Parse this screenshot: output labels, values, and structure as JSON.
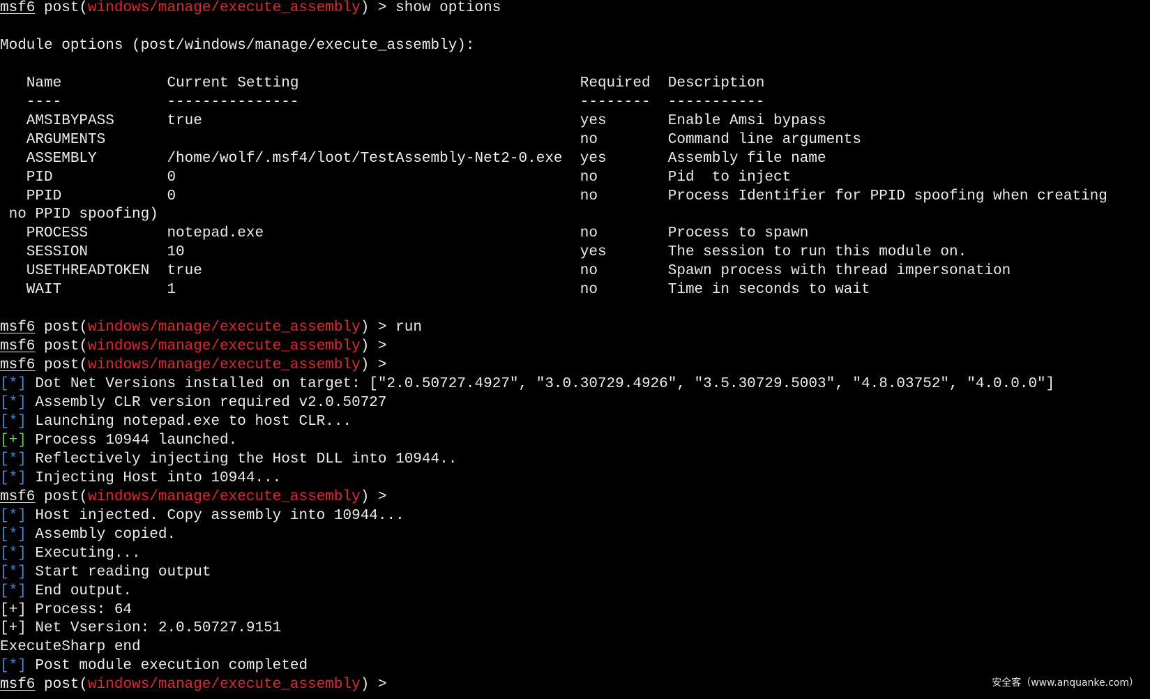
{
  "colors": {
    "background": "#000000",
    "text": "#ececec",
    "module_path": "#e8242a",
    "info_bracket": "#3d8ed6",
    "success_bracket": "#62d12b"
  },
  "prompt": {
    "msf": "msf6",
    "post": " post(",
    "module": "windows/manage/execute_assembly",
    "close": ") > "
  },
  "lines": [
    {
      "type": "prompt",
      "text": "show options"
    },
    {
      "type": "blank",
      "text": ""
    },
    {
      "type": "text",
      "text": "Module options (post/windows/manage/execute_assembly):"
    },
    {
      "type": "blank",
      "text": ""
    },
    {
      "type": "text",
      "text": "   Name            Current Setting                                Required  Description"
    },
    {
      "type": "text",
      "text": "   ----            ---------------                                --------  -----------"
    },
    {
      "type": "text",
      "text": "   AMSIBYPASS      true                                           yes       Enable Amsi bypass"
    },
    {
      "type": "text",
      "text": "   ARGUMENTS                                                      no        Command line arguments"
    },
    {
      "type": "text",
      "text": "   ASSEMBLY        /home/wolf/.msf4/loot/TestAssembly-Net2-0.exe  yes       Assembly file name"
    },
    {
      "type": "text",
      "text": "   PID             0                                              no        Pid  to inject"
    },
    {
      "type": "text",
      "text": "   PPID            0                                              no        Process Identifier for PPID spoofing when creating"
    },
    {
      "type": "text",
      "text": " no PPID spoofing)"
    },
    {
      "type": "text",
      "text": "   PROCESS         notepad.exe                                    no        Process to spawn"
    },
    {
      "type": "text",
      "text": "   SESSION         10                                             yes       The session to run this module on."
    },
    {
      "type": "text",
      "text": "   USETHREADTOKEN  true                                           no        Spawn process with thread impersonation"
    },
    {
      "type": "text",
      "text": "   WAIT            1                                              no        Time in seconds to wait"
    },
    {
      "type": "blank",
      "text": ""
    },
    {
      "type": "prompt",
      "text": "run"
    },
    {
      "type": "prompt",
      "text": ""
    },
    {
      "type": "prompt",
      "text": ""
    },
    {
      "type": "info",
      "marker": "[*]",
      "text": " Dot Net Versions installed on target: [\"2.0.50727.4927\", \"3.0.30729.4926\", \"3.5.30729.5003\", \"4.8.03752\", \"4.0.0.0\"]"
    },
    {
      "type": "info",
      "marker": "[*]",
      "text": " Assembly CLR version required v2.0.50727"
    },
    {
      "type": "info",
      "marker": "[*]",
      "text": " Launching notepad.exe to host CLR..."
    },
    {
      "type": "success",
      "marker": "[+]",
      "text": " Process 10944 launched."
    },
    {
      "type": "info",
      "marker": "[*]",
      "text": " Reflectively injecting the Host DLL into 10944.."
    },
    {
      "type": "info",
      "marker": "[*]",
      "text": " Injecting Host into 10944..."
    },
    {
      "type": "prompt",
      "text": ""
    },
    {
      "type": "info",
      "marker": "[*]",
      "text": " Host injected. Copy assembly into 10944..."
    },
    {
      "type": "info",
      "marker": "[*]",
      "text": " Assembly copied."
    },
    {
      "type": "info",
      "marker": "[*]",
      "text": " Executing..."
    },
    {
      "type": "info",
      "marker": "[*]",
      "text": " Start reading output"
    },
    {
      "type": "info",
      "marker": "[*]",
      "text": " End output."
    },
    {
      "type": "plain-plus",
      "marker": "[+]",
      "text": " Process: 64"
    },
    {
      "type": "plain-plus",
      "marker": "[+]",
      "text": " Net Vsersion: 2.0.50727.9151"
    },
    {
      "type": "text",
      "text": "ExecuteSharp end"
    },
    {
      "type": "info",
      "marker": "[*]",
      "text": " Post module execution completed"
    },
    {
      "type": "prompt",
      "text": ""
    }
  ],
  "watermark": "安全客（www.anquanke.com）"
}
